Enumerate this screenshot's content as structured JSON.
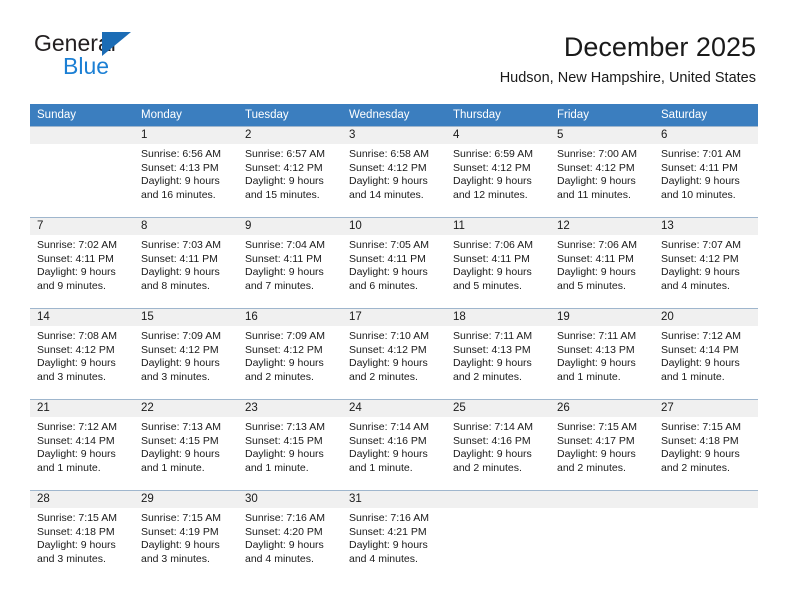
{
  "brand": {
    "line1": "General",
    "line2": "Blue",
    "triangle_color": "#1b6cb5",
    "line2_color": "#1b7fd4"
  },
  "header": {
    "title": "December 2025",
    "subtitle": "Hudson, New Hampshire, United States"
  },
  "theme": {
    "header_bar_color": "#3b7ebf",
    "daynum_band_color": "#f0f0f0",
    "row_divider_color": "#9fb6cd",
    "text_color": "#1a1a1a"
  },
  "weekdays": [
    "Sunday",
    "Monday",
    "Tuesday",
    "Wednesday",
    "Thursday",
    "Friday",
    "Saturday"
  ],
  "weeks": [
    [
      {
        "day": "",
        "empty": true,
        "l1": "",
        "l2": "",
        "l3": "",
        "l4": ""
      },
      {
        "day": "1",
        "l1": "Sunrise: 6:56 AM",
        "l2": "Sunset: 4:13 PM",
        "l3": "Daylight: 9 hours",
        "l4": "and 16 minutes."
      },
      {
        "day": "2",
        "l1": "Sunrise: 6:57 AM",
        "l2": "Sunset: 4:12 PM",
        "l3": "Daylight: 9 hours",
        "l4": "and 15 minutes."
      },
      {
        "day": "3",
        "l1": "Sunrise: 6:58 AM",
        "l2": "Sunset: 4:12 PM",
        "l3": "Daylight: 9 hours",
        "l4": "and 14 minutes."
      },
      {
        "day": "4",
        "l1": "Sunrise: 6:59 AM",
        "l2": "Sunset: 4:12 PM",
        "l3": "Daylight: 9 hours",
        "l4": "and 12 minutes."
      },
      {
        "day": "5",
        "l1": "Sunrise: 7:00 AM",
        "l2": "Sunset: 4:12 PM",
        "l3": "Daylight: 9 hours",
        "l4": "and 11 minutes."
      },
      {
        "day": "6",
        "l1": "Sunrise: 7:01 AM",
        "l2": "Sunset: 4:11 PM",
        "l3": "Daylight: 9 hours",
        "l4": "and 10 minutes."
      }
    ],
    [
      {
        "day": "7",
        "l1": "Sunrise: 7:02 AM",
        "l2": "Sunset: 4:11 PM",
        "l3": "Daylight: 9 hours",
        "l4": "and 9 minutes."
      },
      {
        "day": "8",
        "l1": "Sunrise: 7:03 AM",
        "l2": "Sunset: 4:11 PM",
        "l3": "Daylight: 9 hours",
        "l4": "and 8 minutes."
      },
      {
        "day": "9",
        "l1": "Sunrise: 7:04 AM",
        "l2": "Sunset: 4:11 PM",
        "l3": "Daylight: 9 hours",
        "l4": "and 7 minutes."
      },
      {
        "day": "10",
        "l1": "Sunrise: 7:05 AM",
        "l2": "Sunset: 4:11 PM",
        "l3": "Daylight: 9 hours",
        "l4": "and 6 minutes."
      },
      {
        "day": "11",
        "l1": "Sunrise: 7:06 AM",
        "l2": "Sunset: 4:11 PM",
        "l3": "Daylight: 9 hours",
        "l4": "and 5 minutes."
      },
      {
        "day": "12",
        "l1": "Sunrise: 7:06 AM",
        "l2": "Sunset: 4:11 PM",
        "l3": "Daylight: 9 hours",
        "l4": "and 5 minutes."
      },
      {
        "day": "13",
        "l1": "Sunrise: 7:07 AM",
        "l2": "Sunset: 4:12 PM",
        "l3": "Daylight: 9 hours",
        "l4": "and 4 minutes."
      }
    ],
    [
      {
        "day": "14",
        "l1": "Sunrise: 7:08 AM",
        "l2": "Sunset: 4:12 PM",
        "l3": "Daylight: 9 hours",
        "l4": "and 3 minutes."
      },
      {
        "day": "15",
        "l1": "Sunrise: 7:09 AM",
        "l2": "Sunset: 4:12 PM",
        "l3": "Daylight: 9 hours",
        "l4": "and 3 minutes."
      },
      {
        "day": "16",
        "l1": "Sunrise: 7:09 AM",
        "l2": "Sunset: 4:12 PM",
        "l3": "Daylight: 9 hours",
        "l4": "and 2 minutes."
      },
      {
        "day": "17",
        "l1": "Sunrise: 7:10 AM",
        "l2": "Sunset: 4:12 PM",
        "l3": "Daylight: 9 hours",
        "l4": "and 2 minutes."
      },
      {
        "day": "18",
        "l1": "Sunrise: 7:11 AM",
        "l2": "Sunset: 4:13 PM",
        "l3": "Daylight: 9 hours",
        "l4": "and 2 minutes."
      },
      {
        "day": "19",
        "l1": "Sunrise: 7:11 AM",
        "l2": "Sunset: 4:13 PM",
        "l3": "Daylight: 9 hours",
        "l4": "and 1 minute."
      },
      {
        "day": "20",
        "l1": "Sunrise: 7:12 AM",
        "l2": "Sunset: 4:14 PM",
        "l3": "Daylight: 9 hours",
        "l4": "and 1 minute."
      }
    ],
    [
      {
        "day": "21",
        "l1": "Sunrise: 7:12 AM",
        "l2": "Sunset: 4:14 PM",
        "l3": "Daylight: 9 hours",
        "l4": "and 1 minute."
      },
      {
        "day": "22",
        "l1": "Sunrise: 7:13 AM",
        "l2": "Sunset: 4:15 PM",
        "l3": "Daylight: 9 hours",
        "l4": "and 1 minute."
      },
      {
        "day": "23",
        "l1": "Sunrise: 7:13 AM",
        "l2": "Sunset: 4:15 PM",
        "l3": "Daylight: 9 hours",
        "l4": "and 1 minute."
      },
      {
        "day": "24",
        "l1": "Sunrise: 7:14 AM",
        "l2": "Sunset: 4:16 PM",
        "l3": "Daylight: 9 hours",
        "l4": "and 1 minute."
      },
      {
        "day": "25",
        "l1": "Sunrise: 7:14 AM",
        "l2": "Sunset: 4:16 PM",
        "l3": "Daylight: 9 hours",
        "l4": "and 2 minutes."
      },
      {
        "day": "26",
        "l1": "Sunrise: 7:15 AM",
        "l2": "Sunset: 4:17 PM",
        "l3": "Daylight: 9 hours",
        "l4": "and 2 minutes."
      },
      {
        "day": "27",
        "l1": "Sunrise: 7:15 AM",
        "l2": "Sunset: 4:18 PM",
        "l3": "Daylight: 9 hours",
        "l4": "and 2 minutes."
      }
    ],
    [
      {
        "day": "28",
        "l1": "Sunrise: 7:15 AM",
        "l2": "Sunset: 4:18 PM",
        "l3": "Daylight: 9 hours",
        "l4": "and 3 minutes."
      },
      {
        "day": "29",
        "l1": "Sunrise: 7:15 AM",
        "l2": "Sunset: 4:19 PM",
        "l3": "Daylight: 9 hours",
        "l4": "and 3 minutes."
      },
      {
        "day": "30",
        "l1": "Sunrise: 7:16 AM",
        "l2": "Sunset: 4:20 PM",
        "l3": "Daylight: 9 hours",
        "l4": "and 4 minutes."
      },
      {
        "day": "31",
        "l1": "Sunrise: 7:16 AM",
        "l2": "Sunset: 4:21 PM",
        "l3": "Daylight: 9 hours",
        "l4": "and 4 minutes."
      },
      {
        "day": "",
        "empty": true,
        "l1": "",
        "l2": "",
        "l3": "",
        "l4": ""
      },
      {
        "day": "",
        "empty": true,
        "l1": "",
        "l2": "",
        "l3": "",
        "l4": ""
      },
      {
        "day": "",
        "empty": true,
        "l1": "",
        "l2": "",
        "l3": "",
        "l4": ""
      }
    ]
  ]
}
